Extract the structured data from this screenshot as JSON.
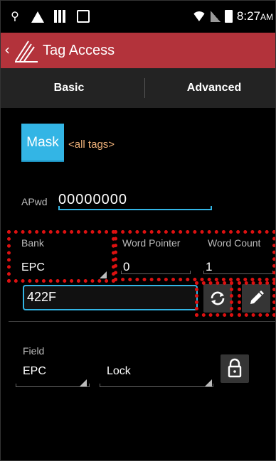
{
  "status_bar": {
    "time": "8:27",
    "ampm": "AM",
    "icons": [
      "usb-icon",
      "warning-icon",
      "barcode-icon",
      "bag-icon",
      "wifi-icon",
      "signal-icon",
      "battery-icon"
    ]
  },
  "app_bar": {
    "back_symbol": "‹",
    "logo_icon": "logo-icon",
    "title": "Tag Access"
  },
  "tabs": [
    {
      "label": "Basic",
      "selected": false
    },
    {
      "label": "Advanced",
      "selected": true
    }
  ],
  "mask": {
    "button_label": "Mask",
    "filter_text": "<all tags>"
  },
  "apwd": {
    "label": "APwd",
    "value": "00000000"
  },
  "bank": {
    "label": "Bank",
    "value": "EPC"
  },
  "word_pointer": {
    "label": "Word Pointer",
    "value": "0"
  },
  "word_count": {
    "label": "Word Count",
    "value": "1"
  },
  "data_field": {
    "value": "422F"
  },
  "actions": {
    "refresh_icon": "refresh-icon",
    "edit_icon": "pencil-icon",
    "lock_icon": "lock-icon"
  },
  "lock_section": {
    "label": "Field",
    "field_value": "EPC",
    "action_value": "Lock"
  },
  "colors": {
    "app_bar": "#b3333b",
    "accent": "#33b5e5",
    "highlight": "#dd1111"
  }
}
